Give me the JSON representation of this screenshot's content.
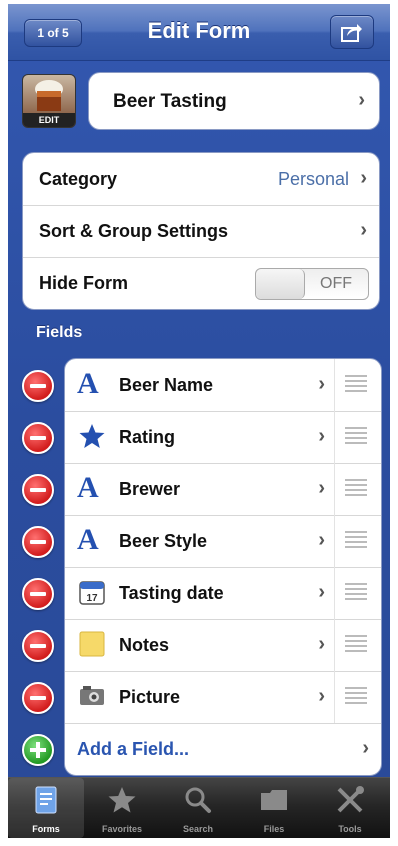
{
  "nav": {
    "pager": "1 of 5",
    "title": "Edit Form"
  },
  "form": {
    "edit_label": "EDIT",
    "name": "Beer Tasting"
  },
  "settings": {
    "category_label": "Category",
    "category_value": "Personal",
    "sort_label": "Sort & Group Settings",
    "hide_label": "Hide Form",
    "hide_toggle": "OFF"
  },
  "fields_header": "Fields",
  "fields": [
    {
      "label": "Beer Name",
      "icon": "text-icon"
    },
    {
      "label": "Rating",
      "icon": "star-icon"
    },
    {
      "label": "Brewer",
      "icon": "text-icon"
    },
    {
      "label": "Beer Style",
      "icon": "text-icon"
    },
    {
      "label": "Tasting date",
      "icon": "calendar-icon"
    },
    {
      "label": "Notes",
      "icon": "note-icon"
    },
    {
      "label": "Picture",
      "icon": "camera-icon"
    }
  ],
  "add_field": "Add a Field...",
  "tabs": [
    {
      "label": "Forms",
      "icon": "forms-icon"
    },
    {
      "label": "Favorites",
      "icon": "star-icon"
    },
    {
      "label": "Search",
      "icon": "search-icon"
    },
    {
      "label": "Files",
      "icon": "folder-icon"
    },
    {
      "label": "Tools",
      "icon": "tools-icon"
    }
  ]
}
